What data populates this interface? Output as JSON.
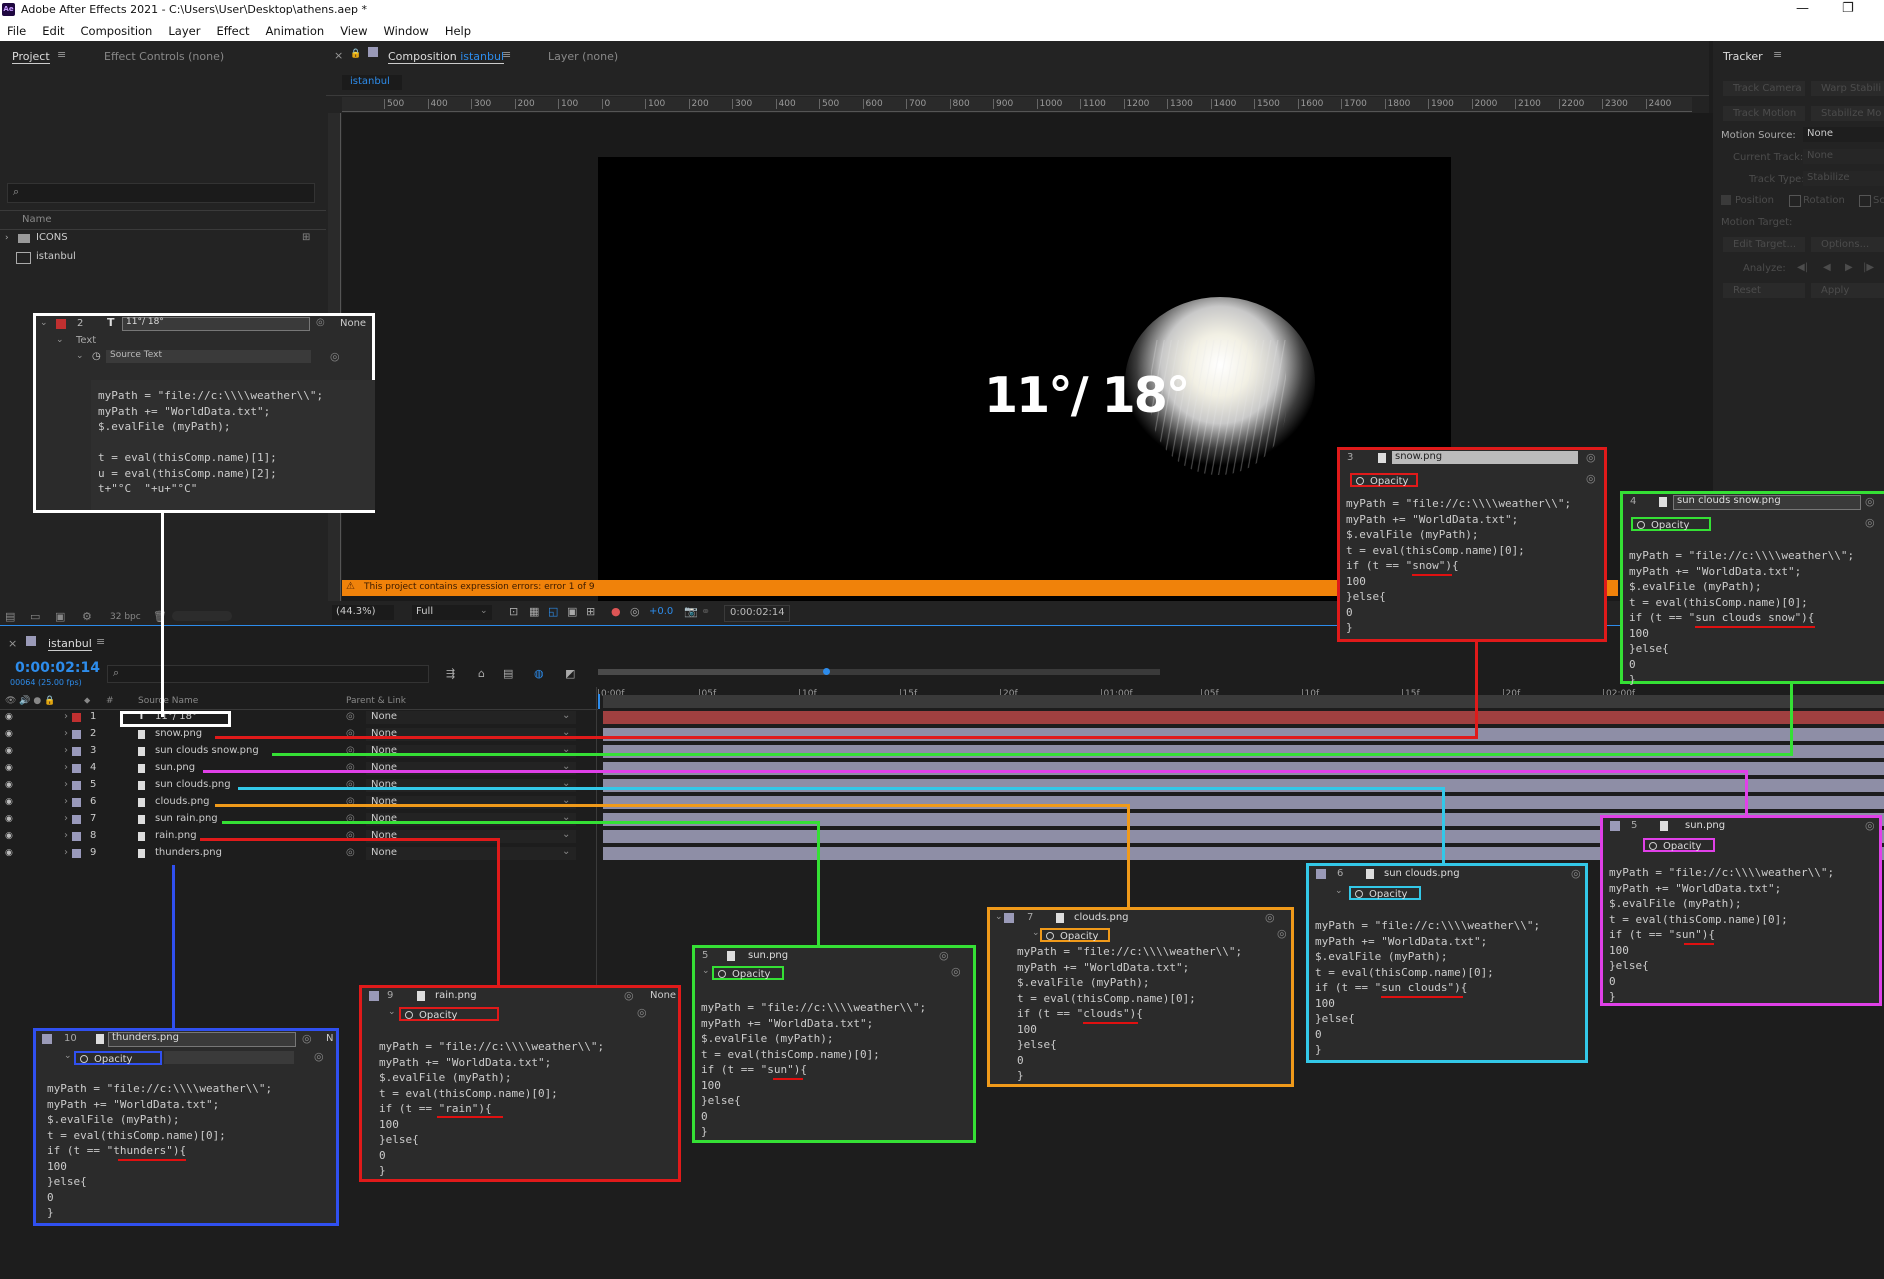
{
  "app": {
    "title": "Adobe After Effects 2021 - C:\\Users\\User\\Desktop\\athens.aep *",
    "icon": "Ae"
  },
  "menu": [
    "File",
    "Edit",
    "Composition",
    "Layer",
    "Effect",
    "Animation",
    "View",
    "Window",
    "Help"
  ],
  "project_panel": {
    "tab": "Project",
    "effect_controls": "Effect Controls (none)",
    "col_name": "Name",
    "items": [
      "ICONS",
      "istanbul"
    ],
    "bpc": "32 bpc"
  },
  "comp_panel": {
    "tab_prefix": "Composition",
    "comp": "istanbul",
    "layer_tab": "Layer (none)",
    "comp_tab": "istanbul",
    "ruler": [
      "500",
      "400",
      "300",
      "200",
      "100",
      "0",
      "100",
      "200",
      "300",
      "400",
      "500",
      "600",
      "700",
      "800",
      "900",
      "1000",
      "1100",
      "1200",
      "1300",
      "1400",
      "1500",
      "1600",
      "1700",
      "1800",
      "1900",
      "2000",
      "2100",
      "2200",
      "2300",
      "2400"
    ],
    "temp_text": "11°/ 18°",
    "error": "This project contains expression errors: error 1 of 9",
    "zoom": "(44.3%)",
    "resolution": "Full",
    "exposure": "+0.0",
    "timecode": "0:00:02:14"
  },
  "timeline": {
    "tab": "istanbul",
    "timecode": "0:00:02:14",
    "frames": "00064 (25.00 fps)",
    "col_source": "Source Name",
    "col_parent": "Parent & Link",
    "ruler": [
      "0:00f",
      "05f",
      "10f",
      "15f",
      "20f",
      "01:00f",
      "05f",
      "10f",
      "15f",
      "20f",
      "02:00f"
    ],
    "layers": [
      {
        "num": "1",
        "name": "11°/ 18°",
        "parent": "None"
      },
      {
        "num": "2",
        "name": "snow.png",
        "parent": "None"
      },
      {
        "num": "3",
        "name": "sun clouds snow.png",
        "parent": "None"
      },
      {
        "num": "4",
        "name": "sun.png",
        "parent": "None"
      },
      {
        "num": "5",
        "name": "sun clouds.png",
        "parent": "None"
      },
      {
        "num": "6",
        "name": "clouds.png",
        "parent": "None"
      },
      {
        "num": "7",
        "name": "sun rain.png",
        "parent": "None"
      },
      {
        "num": "8",
        "name": "rain.png",
        "parent": "None"
      },
      {
        "num": "9",
        "name": "thunders.png",
        "parent": "None"
      }
    ]
  },
  "tracker": {
    "title": "Tracker",
    "track_camera": "Track Camera",
    "warp_stab": "Warp Stabili",
    "track_motion": "Track Motion",
    "stabilize": "Stabilize Mo",
    "motion_source_label": "Motion Source:",
    "motion_source": "None",
    "current_track_label": "Current Track:",
    "current_track": "None",
    "track_type_label": "Track Type:",
    "track_type": "Stabilize",
    "position": "Position",
    "rotation": "Rotation",
    "scale": "Sc",
    "motion_target": "Motion Target:",
    "edit_target": "Edit Target...",
    "options": "Options...",
    "analyze": "Analyze:",
    "reset": "Reset",
    "apply": "Apply"
  },
  "callouts": {
    "text": {
      "num": "2",
      "name": "11°/ 18°",
      "parent": "None",
      "group": "Text",
      "prop": "Source Text",
      "code": "myPath = \"file://c:\\\\\\\\weather\\\\\";\nmyPath += \"WorldData.txt\";\n$.evalFile (myPath);\n\nt = eval(thisComp.name)[1];\nu = eval(thisComp.name)[2];\nt+\"°C  \"+u+\"°C\""
    },
    "snow": {
      "num": "3",
      "name": "snow.png",
      "prop": "Opacity",
      "code": "myPath = \"file://c:\\\\\\\\weather\\\\\";\nmyPath += \"WorldData.txt\";\n$.evalFile (myPath);\nt = eval(thisComp.name)[0];\nif (t == \"snow\"){\n100\n}else{\n0\n}"
    },
    "sun_clouds_snow": {
      "num": "4",
      "name": "sun clouds snow.png",
      "prop": "Opacity",
      "code": "myPath = \"file://c:\\\\\\\\weather\\\\\";\nmyPath += \"WorldData.txt\";\n$.evalFile (myPath);\nt = eval(thisComp.name)[0];\nif (t == \"sun clouds snow\"){\n100\n}else{\n0\n}"
    },
    "sun_right": {
      "num": "5",
      "name": "sun.png",
      "prop": "Opacity",
      "code": "myPath = \"file://c:\\\\\\\\weather\\\\\";\nmyPath += \"WorldData.txt\";\n$.evalFile (myPath);\nt = eval(thisComp.name)[0];\nif (t == \"sun\"){\n100\n}else{\n0\n}"
    },
    "sun_clouds": {
      "num": "6",
      "name": "sun clouds.png",
      "prop": "Opacity",
      "code": "myPath = \"file://c:\\\\\\\\weather\\\\\";\nmyPath += \"WorldData.txt\";\n$.evalFile (myPath);\nt = eval(thisComp.name)[0];\nif (t == \"sun clouds\"){\n100\n}else{\n0\n}"
    },
    "clouds": {
      "num": "7",
      "name": "clouds.png",
      "prop": "Opacity",
      "code": "myPath = \"file://c:\\\\\\\\weather\\\\\";\nmyPath += \"WorldData.txt\";\n$.evalFile (myPath);\nt = eval(thisComp.name)[0];\nif (t == \"clouds\"){\n100\n}else{\n0\n}"
    },
    "sun_mid": {
      "num": "5",
      "name": "sun.png",
      "prop": "Opacity",
      "code": "myPath = \"file://c:\\\\\\\\weather\\\\\";\nmyPath += \"WorldData.txt\";\n$.evalFile (myPath);\nt = eval(thisComp.name)[0];\nif (t == \"sun\"){\n100\n}else{\n0\n}"
    },
    "rain": {
      "num": "9",
      "name": "rain.png",
      "parent": "None",
      "prop": "Opacity",
      "code": "myPath = \"file://c:\\\\\\\\weather\\\\\";\nmyPath += \"WorldData.txt\";\n$.evalFile (myPath);\nt = eval(thisComp.name)[0];\nif (t == \"rain\"){\n100\n}else{\n0\n}"
    },
    "thunders": {
      "num": "10",
      "name": "thunders.png",
      "parent": "N",
      "prop": "Opacity",
      "code": "myPath = \"file://c:\\\\\\\\weather\\\\\";\nmyPath += \"WorldData.txt\";\n$.evalFile (myPath);\nt = eval(thisComp.name)[0];\nif (t == \"thunders\"){\n100\n}else{\n0\n}"
    }
  },
  "colors": {
    "accent_blue": "#2d8ceb",
    "error_orange": "#f0820a",
    "white": "#ffffff",
    "red": "#e01a1a",
    "green": "#35e035",
    "magenta": "#e040e8",
    "cyan": "#33c8e8",
    "orange": "#f09a1a",
    "blue": "#3050f0"
  }
}
